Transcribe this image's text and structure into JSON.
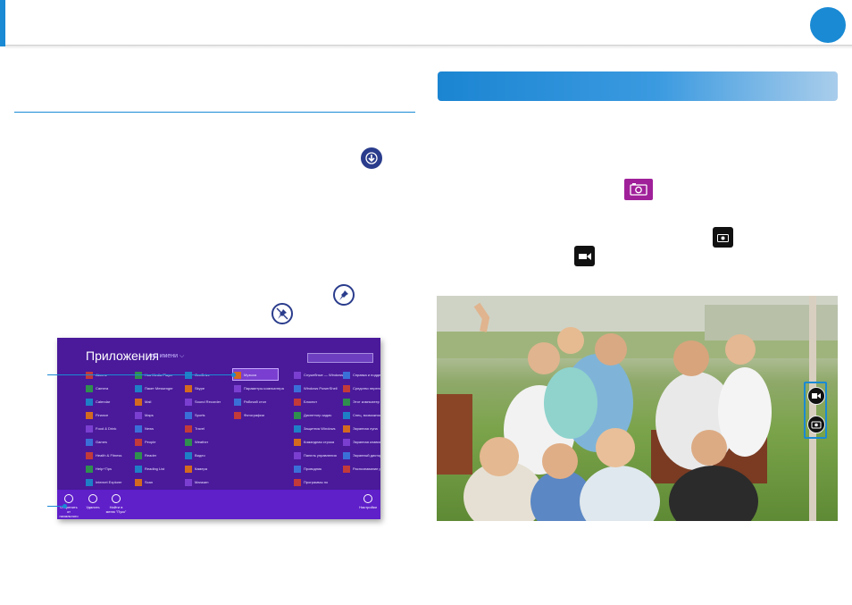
{
  "left_panel": {
    "start_screen": {
      "title": "Приложения",
      "sort": "по имени ⌵",
      "selected_app": "Музыка",
      "apps": [
        [
          "Alarms",
          "Camera",
          "Calendar",
          "Finance",
          "Food & Drink",
          "Games",
          "Health & Fitness",
          "Help+Tips",
          "Internet Explorer"
        ],
        [
          "Нов Media Player",
          "Пакет Messenger",
          "Mail",
          "Maps",
          "News",
          "People",
          "Reader",
          "Reading List",
          "Scan"
        ],
        [
          "OneDrive",
          "Skype",
          "Sound Recorder",
          "Sports",
          "Travel",
          "Weather",
          "Видео",
          "Камера",
          "Магазин"
        ],
        [
          "Музыка",
          "Параметры компьютера",
          "Рабочий стол",
          "Фотографии"
        ],
        [
          "Служебные — Windows",
          "Windows PowerShell",
          "Блокнот",
          "Диспетчер задач",
          "Защитник Windows",
          "Командная строка",
          "Панель управления",
          "Проводник",
          "Программы по"
        ],
        [
          "Справка и поддержка",
          "Средство переноса данн",
          "Этот компьютер",
          "Спец. возможности",
          "Экранная лупа",
          "Экранная клавиатура",
          "Экранный диктор",
          "Распознавание речи Windows",
          ""
        ]
      ],
      "appbar": {
        "unpin_label": "Открепить от начального экрана",
        "delete_label": "Удалить",
        "find_label": "Найти в меню \"Пуск\"",
        "settings_label": "Настройки"
      }
    }
  },
  "icons": {
    "download": "download-circle-icon",
    "pin": "pin-icon",
    "unpin": "unpin-icon",
    "camera_app": "camera-app-icon",
    "photo_mode": "photo-mode-icon",
    "video_mode": "video-mode-icon"
  },
  "colors": {
    "accent": "#1a8ad4",
    "start_bg": "#4a1a9a",
    "camera_tile": "#a0209a"
  }
}
